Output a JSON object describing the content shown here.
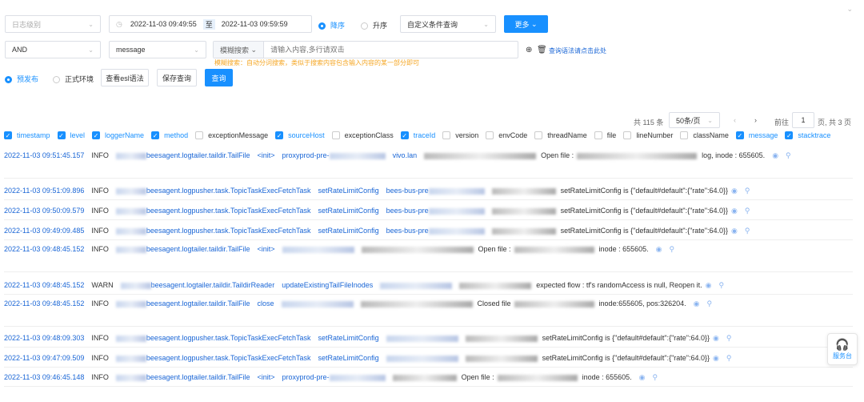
{
  "filters": {
    "level_placeholder": "日志级别",
    "time_start": "2022-11-03 09:49:55",
    "time_sep": "至",
    "time_end": "2022-11-03 09:59:59",
    "desc": "降序",
    "asc": "升序",
    "custom_query": "自定义条件查询",
    "more": "更多"
  },
  "query": {
    "logic": "AND",
    "field": "message",
    "mode": "模糊搜索",
    "input_placeholder": "请输入内容,多行请双击",
    "hint": "模糊搜索：自动分词搜索，类似于搜索内容包含输入内容的某一部分即可",
    "syntax_link": "查询语法请点击此处"
  },
  "env": {
    "pre": "预发布",
    "prod": "正式环境",
    "view_esl": "查看esl语法",
    "save": "保存查询",
    "search": "查询"
  },
  "pagination": {
    "total": "共 115 条",
    "page_size": "50条/页",
    "goto": "前往",
    "page": "1",
    "pages": "页, 共 3 页"
  },
  "columns": [
    {
      "name": "timestamp",
      "on": true
    },
    {
      "name": "level",
      "on": true
    },
    {
      "name": "loggerName",
      "on": true
    },
    {
      "name": "method",
      "on": true
    },
    {
      "name": "exceptionMessage",
      "on": false
    },
    {
      "name": "sourceHost",
      "on": true
    },
    {
      "name": "exceptionClass",
      "on": false
    },
    {
      "name": "traceId",
      "on": true
    },
    {
      "name": "version",
      "on": false
    },
    {
      "name": "envCode",
      "on": false
    },
    {
      "name": "threadName",
      "on": false
    },
    {
      "name": "file",
      "on": false
    },
    {
      "name": "lineNumber",
      "on": false
    },
    {
      "name": "className",
      "on": false
    },
    {
      "name": "message",
      "on": true
    },
    {
      "name": "stacktrace",
      "on": true
    }
  ],
  "rows": [
    {
      "ts": "2022-11-03 09:51:45.157",
      "level": "INFO",
      "logger": "beesagent.logtailer.taildir.TailFile",
      "method": "<init>",
      "host": "proxyprod-pre-",
      "host2": "vivo.lan",
      "msg": "Open file :",
      "msg2": "log, inode : 655605.",
      "wrap": true
    },
    {
      "ts": "2022-11-03 09:51:09.896",
      "level": "INFO",
      "logger": "beesagent.logpusher.task.TopicTaskExecFetchTask",
      "method": "setRateLimitConfig",
      "host": "bees-bus-pre",
      "host2": "",
      "msg": "setRateLimitConfig is {\"default#default\":{\"rate\":64.0}}",
      "msg2": "",
      "wrap": false
    },
    {
      "ts": "2022-11-03 09:50:09.579",
      "level": "INFO",
      "logger": "beesagent.logpusher.task.TopicTaskExecFetchTask",
      "method": "setRateLimitConfig",
      "host": "bees-bus-pre",
      "host2": "",
      "msg": "setRateLimitConfig is {\"default#default\":{\"rate\":64.0}}",
      "msg2": "",
      "wrap": false
    },
    {
      "ts": "2022-11-03 09:49:09.485",
      "level": "INFO",
      "logger": "beesagent.logpusher.task.TopicTaskExecFetchTask",
      "method": "setRateLimitConfig",
      "host": "bees-bus-pre",
      "host2": "",
      "msg": "setRateLimitConfig is {\"default#default\":{\"rate\":64.0}}",
      "msg2": "",
      "wrap": false
    },
    {
      "ts": "2022-11-03 09:48:45.152",
      "level": "INFO",
      "logger": "beesagent.logtailer.taildir.TailFile",
      "method": "<init>",
      "host": "",
      "host2": "",
      "msg": "Open file :",
      "msg2": "inode : 655605.",
      "wrap": true
    },
    {
      "ts": "2022-11-03 09:48:45.152",
      "level": "WARN",
      "logger": "beesagent.logtailer.taildir.TaildirReader",
      "method": "updateExistingTailFileInodes",
      "host": "",
      "host2": "",
      "msg": "expected flow : tf's randomAccess is null, Reopen it.",
      "msg2": "",
      "wrap": false
    },
    {
      "ts": "2022-11-03 09:48:45.152",
      "level": "INFO",
      "logger": "beesagent.logtailer.taildir.TailFile",
      "method": "close",
      "host": "",
      "host2": "",
      "msg": "Closed file",
      "msg2": "inode:655605, pos:326204.",
      "wrap": true
    },
    {
      "ts": "2022-11-03 09:48:09.303",
      "level": "INFO",
      "logger": "beesagent.logpusher.task.TopicTaskExecFetchTask",
      "method": "setRateLimitConfig",
      "host": "",
      "host2": "",
      "msg": "setRateLimitConfig is {\"default#default\":{\"rate\":64.0}}",
      "msg2": "",
      "wrap": false
    },
    {
      "ts": "2022-11-03 09:47:09.509",
      "level": "INFO",
      "logger": "beesagent.logpusher.task.TopicTaskExecFetchTask",
      "method": "setRateLimitConfig",
      "host": "",
      "host2": "",
      "msg": "setRateLimitConfig is {\"default#default\":{\"rate\":64.0}}",
      "msg2": "",
      "wrap": false
    },
    {
      "ts": "2022-11-03 09:46:45.148",
      "level": "INFO",
      "logger": "beesagent.logtailer.taildir.TailFile",
      "method": "<init>",
      "host": "proxyprod-pre-",
      "host2": "",
      "msg": "Open file :",
      "msg2": "inode : 655605.",
      "wrap": false
    }
  ],
  "help": "服务台"
}
